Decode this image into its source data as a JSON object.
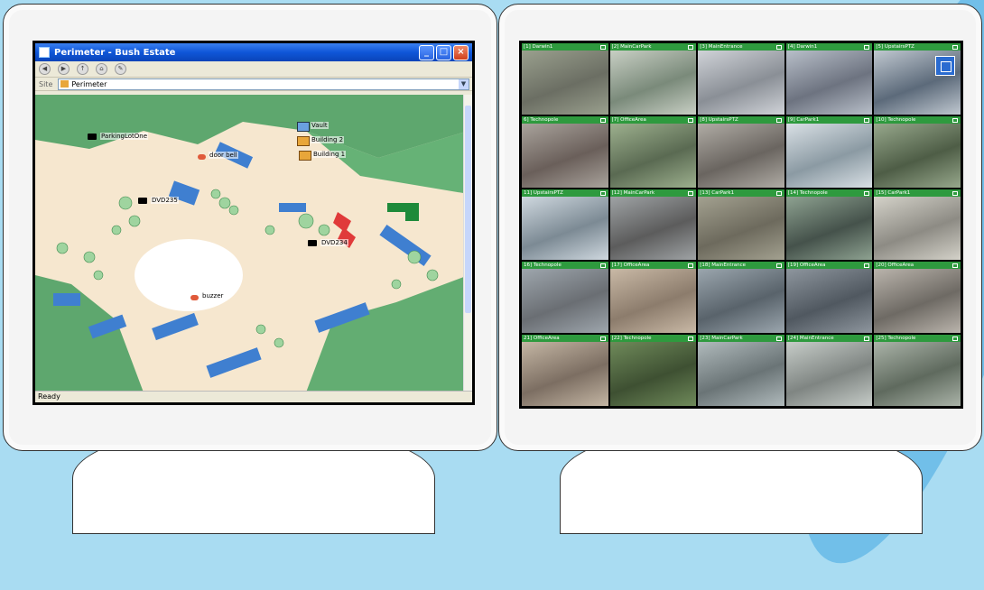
{
  "map_window": {
    "title": "Perimeter - Bush Estate",
    "site_label": "Site",
    "site_value": "Perimeter",
    "status": "Ready",
    "markers": [
      {
        "label": "Vault",
        "kind": "vault"
      },
      {
        "label": "Building 2",
        "kind": "building"
      },
      {
        "label": "Building 1",
        "kind": "building"
      },
      {
        "label": "ParkingLotOne",
        "kind": "camera"
      },
      {
        "label": "door bell",
        "kind": "alarm"
      },
      {
        "label": "DVD235",
        "kind": "camera"
      },
      {
        "label": "DVD234",
        "kind": "camera"
      },
      {
        "label": "buzzer",
        "kind": "alarm"
      }
    ]
  },
  "video_wall": {
    "cells": [
      "[1] Darwin1",
      "[2] MainCarPark",
      "[3] MainEntrance",
      "[4] Darwin1",
      "[5] UpstairsPTZ",
      "6] Technopole",
      "[7] OfficeArea",
      "[8] UpstairsPTZ",
      "[9] CarPark1",
      "[10] Technopole",
      "11] UpstairsPTZ",
      "[12] MainCarPark",
      "[13] CarPark1",
      "[14] Technopole",
      "[15] CarPark1",
      "16] Technopole",
      "[17] OfficeArea",
      "[18] MainEntrance",
      "[19] OfficeArea",
      "[20] OfficeArea",
      "21] OfficeArea",
      "[22] Technopole",
      "[23] MainCarPark",
      "[24] MainEntrance",
      "[25] Technopole"
    ]
  }
}
